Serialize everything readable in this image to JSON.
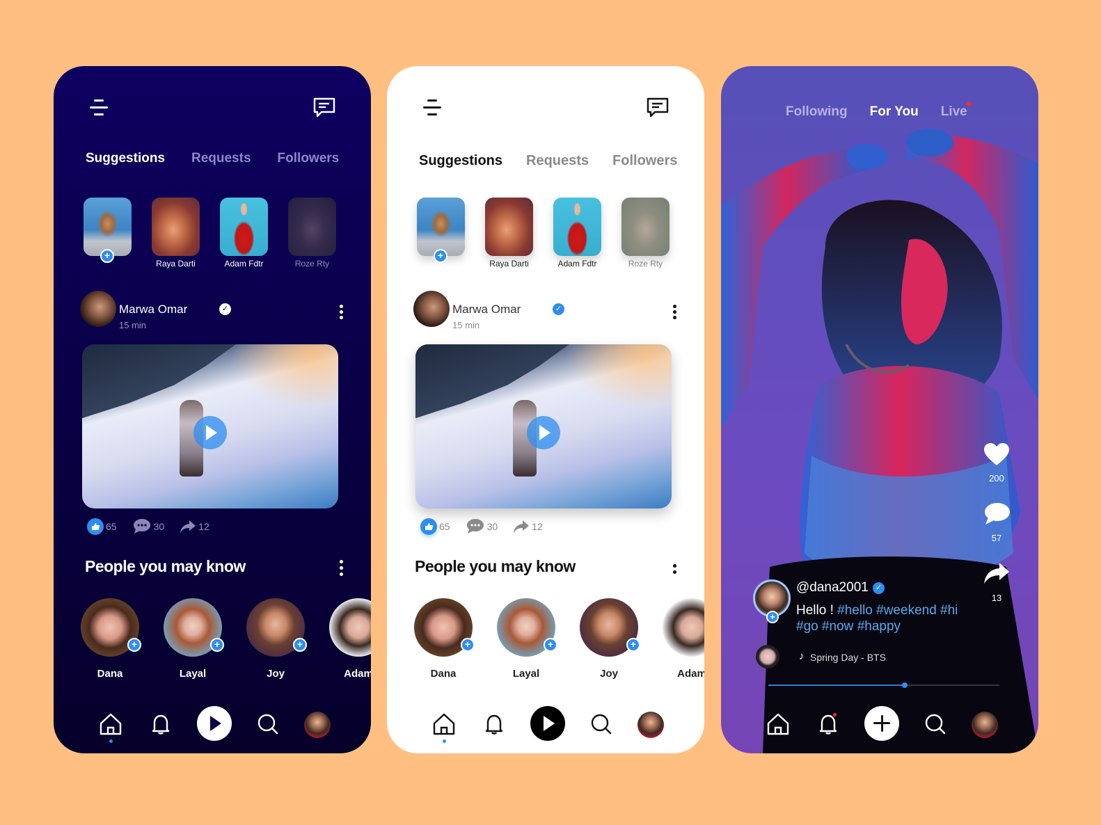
{
  "colors": {
    "background": "#FFBF80",
    "accent_blue": "#2D8EF0",
    "dark_phone_bg": "#0A0048",
    "light_phone_bg": "#FFFFFF",
    "video_phone_bg": "#6A4CC0",
    "live_red": "#FF2A2A",
    "hashtag_blue": "#5AAAF0"
  },
  "icons": {
    "menu": "hamburger-menu-icon",
    "chat": "chat-bubble-icon",
    "verified": "✓",
    "play": "▶",
    "plus": "+",
    "like": "thumbs-up-icon",
    "comment": "comment-icon",
    "share": "share-arrow-icon",
    "home": "home-icon",
    "bell": "bell-icon",
    "search": "search-icon",
    "heart": "heart-icon",
    "music_note": "♪"
  },
  "social_feed": {
    "tabs": [
      {
        "label": "Suggestions",
        "active": true
      },
      {
        "label": "Requests",
        "active": false
      },
      {
        "label": "Followers",
        "active": false
      }
    ],
    "stories": [
      {
        "name": "",
        "is_own": true
      },
      {
        "name": "Raya Darti",
        "is_own": false
      },
      {
        "name": "Adam Fdtr",
        "is_own": false
      },
      {
        "name": "Roze Rty",
        "is_own": false,
        "muted": true
      }
    ],
    "post": {
      "author": "Marwa Omar",
      "verified": true,
      "time": "15 min",
      "likes": "65",
      "comments": "30",
      "shares": "12"
    },
    "people_section_title": "People you may know",
    "people": [
      {
        "name": "Dana"
      },
      {
        "name": "Layal"
      },
      {
        "name": "Joy"
      },
      {
        "name": "Adam"
      }
    ],
    "bottom_nav": {
      "active": "home",
      "items": [
        "home",
        "notifications",
        "play",
        "search",
        "profile"
      ]
    }
  },
  "video_feed": {
    "tabs": [
      {
        "label": "Following",
        "active": false
      },
      {
        "label": "For You",
        "active": true
      },
      {
        "label": "Live",
        "active": false,
        "live_indicator": true
      }
    ],
    "likes": "200",
    "comments": "57",
    "shares": "13",
    "creator_handle": "@dana2001",
    "creator_verified": true,
    "caption_text": "Hello !",
    "hashtags": [
      "#hello",
      "#weekend",
      "#hi",
      "#go",
      "#now",
      "#happy"
    ],
    "song": "Spring Day - BTS",
    "playback_progress": 0.59,
    "bottom_nav": {
      "items": [
        "home",
        "notifications",
        "create",
        "search",
        "profile"
      ],
      "notification_badge": true
    }
  }
}
